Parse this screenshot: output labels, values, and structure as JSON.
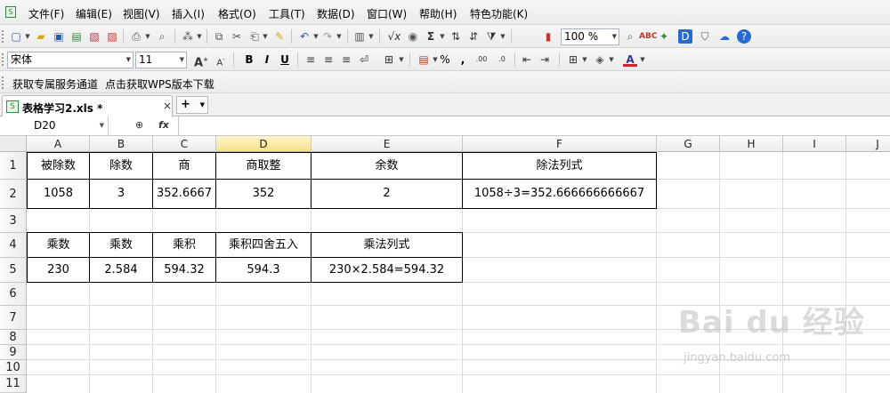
{
  "menubar": {
    "items": [
      "文件(F)",
      "编辑(E)",
      "视图(V)",
      "插入(I)",
      "格式(O)",
      "工具(T)",
      "数据(D)",
      "窗口(W)",
      "帮助(H)",
      "特色功能(K)"
    ]
  },
  "toolbar": {
    "zoom": "100 %"
  },
  "format_bar": {
    "font_name": "宋体",
    "font_size": "11",
    "bold": "B",
    "italic": "I",
    "underline": "U",
    "percent": "%",
    "font_color_letter": "A",
    "underline_color": "#e02020"
  },
  "links": {
    "service": "获取专属服务通道",
    "download": "点击获取WPS版本下载"
  },
  "tabs": {
    "file_tab": "表格学习2.xls *",
    "close": "×",
    "new": "+"
  },
  "formula": {
    "cell_ref": "D20",
    "fx": "fx",
    "content": ""
  },
  "grid": {
    "columns": [
      "A",
      "B",
      "C",
      "D",
      "E",
      "F",
      "G",
      "H",
      "I",
      "J"
    ],
    "active_column": "D",
    "rows": [
      "1",
      "2",
      "3",
      "4",
      "5",
      "6",
      "7",
      "8",
      "9",
      "10",
      "11"
    ],
    "division_table": {
      "headers": [
        "被除数",
        "除数",
        "商",
        "商取整",
        "余数",
        "除法列式"
      ],
      "values": [
        "1058",
        "3",
        "352.6667",
        "352",
        "2",
        "1058÷3=352.666666666667"
      ]
    },
    "multiplication_table": {
      "headers": [
        "乘数",
        "乘数",
        "乘积",
        "乘积四舍五入",
        "乘法列式"
      ],
      "values": [
        "230",
        "2.584",
        "594.32",
        "594.3",
        "230×2.584=594.32"
      ]
    }
  },
  "watermark": {
    "brand": "Bai du 经验",
    "url": "jingyan.baidu.com"
  }
}
